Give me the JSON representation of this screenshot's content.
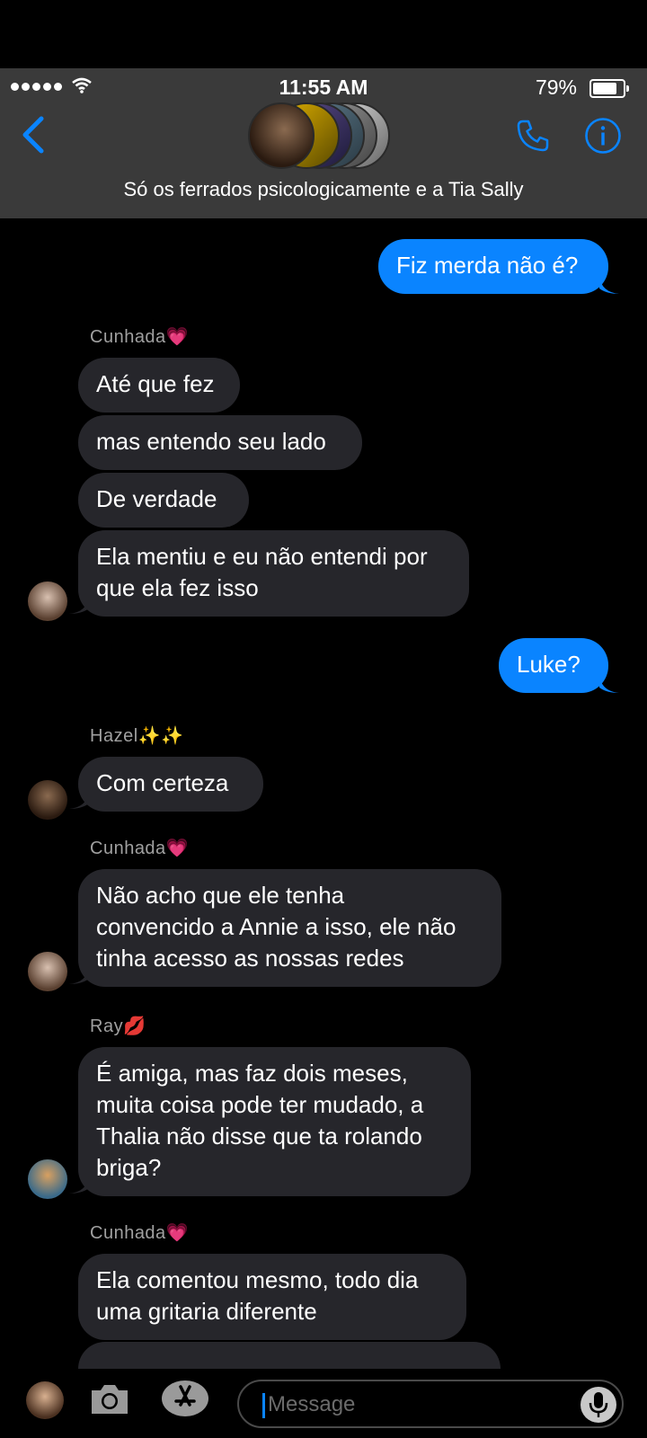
{
  "status_bar": {
    "time": "11:55 AM",
    "battery": "79%"
  },
  "header": {
    "group_name": "Só os ferrados psicologicamente e a Tia Sally"
  },
  "messages": {
    "m1": "Fiz merda não é?",
    "s1": "Cunhada💗",
    "m2": "Até que fez",
    "m3": "mas entendo seu lado",
    "m4": "De verdade",
    "m5a": "Ela mentiu e eu não entendi por",
    "m5b": "que ela fez isso",
    "m6": "Luke?",
    "s2": "Hazel✨✨",
    "m7": "Com certeza",
    "s3": "Cunhada💗",
    "m8a": "Não acho que ele tenha",
    "m8b": "convencido a Annie a isso, ele não",
    "m8c": "tinha acesso as nossas redes",
    "s4": "Ray💋",
    "m9a": "É amiga, mas faz dois meses,",
    "m9b": "muita coisa pode ter mudado, a",
    "m9c": "Thalia não disse que ta rolando",
    "m9d": "briga?",
    "s5": "Cunhada💗",
    "m10a": "Ela comentou mesmo, todo dia",
    "m10b": "uma gritaria diferente"
  },
  "input": {
    "placeholder": "Message"
  },
  "colors": {
    "outgoing": "#0a84ff",
    "incoming": "#26262b",
    "accent": "#0a84ff"
  }
}
